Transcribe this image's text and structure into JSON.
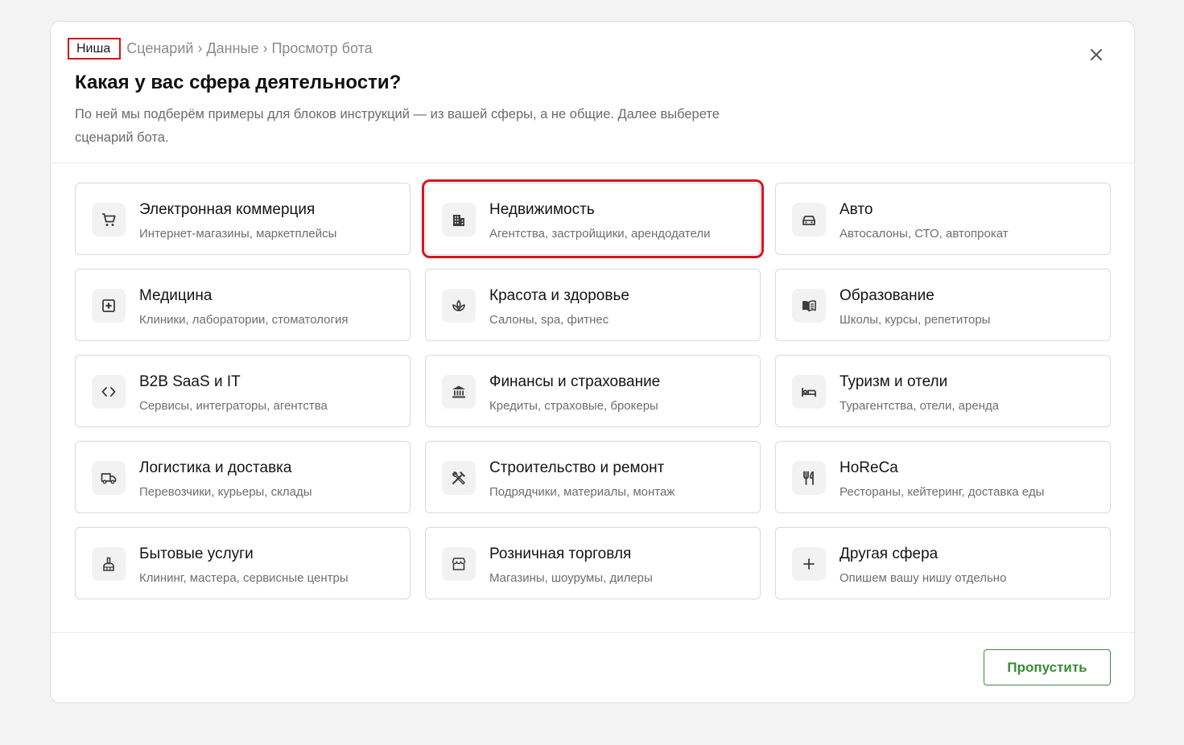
{
  "breadcrumb": {
    "active": "Ниша",
    "steps": [
      "Сценарий",
      "Данные",
      "Просмотр бота"
    ],
    "separator": "›"
  },
  "header": {
    "title": "Какая у вас сфера деятельности?",
    "subtitle": "По ней мы подберём примеры для блоков инструкций — из вашей сферы, а не общие. Далее выберете сценарий бота."
  },
  "niches": [
    {
      "title": "Электронная коммерция",
      "desc": "Интернет-магазины, маркетплейсы",
      "icon": "cart-icon"
    },
    {
      "title": "Недвижимость",
      "desc": "Агентства, застройщики, арендодатели",
      "icon": "building-icon",
      "selected": true
    },
    {
      "title": "Авто",
      "desc": "Автосалоны, СТО, автопрокат",
      "icon": "car-icon"
    },
    {
      "title": "Медицина",
      "desc": "Клиники, лаборатории, стоматология",
      "icon": "medical-icon"
    },
    {
      "title": "Красота и здоровье",
      "desc": "Салоны, spa, фитнес",
      "icon": "spa-icon"
    },
    {
      "title": "Образование",
      "desc": "Школы, курсы, репетиторы",
      "icon": "book-icon"
    },
    {
      "title": "B2B SaaS и IT",
      "desc": "Сервисы, интеграторы, агентства",
      "icon": "code-icon"
    },
    {
      "title": "Финансы и страхование",
      "desc": "Кредиты, страховые, брокеры",
      "icon": "bank-icon"
    },
    {
      "title": "Туризм и отели",
      "desc": "Турагентства, отели, аренда",
      "icon": "bed-icon"
    },
    {
      "title": "Логистика и доставка",
      "desc": "Перевозчики, курьеры, склады",
      "icon": "truck-icon"
    },
    {
      "title": "Строительство и ремонт",
      "desc": "Подрядчики, материалы, монтаж",
      "icon": "tools-icon"
    },
    {
      "title": "HoReCa",
      "desc": "Рестораны, кейтеринг, доставка еды",
      "icon": "restaurant-icon"
    },
    {
      "title": "Бытовые услуги",
      "desc": "Клининг, мастера, сервисные центры",
      "icon": "cleaning-icon"
    },
    {
      "title": "Розничная торговля",
      "desc": "Магазины, шоурумы, дилеры",
      "icon": "store-icon"
    },
    {
      "title": "Другая сфера",
      "desc": "Опишем вашу нишу отдельно",
      "icon": "plus-icon"
    }
  ],
  "footer": {
    "skip_label": "Пропустить"
  },
  "colors": {
    "accent_green": "#3a8a34",
    "highlight_red": "#d9141c",
    "background": "#f3f3f3"
  }
}
